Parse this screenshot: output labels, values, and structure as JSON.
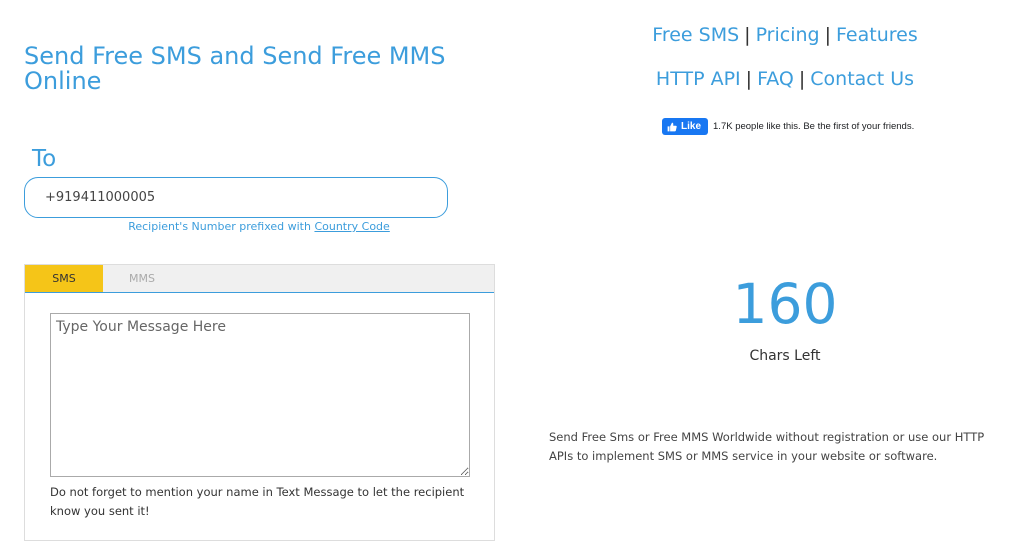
{
  "header": {
    "title": "Send Free SMS and Send Free MMS Online"
  },
  "nav": {
    "row1": [
      "Free SMS",
      "Pricing",
      "Features"
    ],
    "row2": [
      "HTTP API",
      "FAQ",
      "Contact Us"
    ],
    "separator": "|"
  },
  "facebook": {
    "like_label": "Like",
    "like_icon": "thumbs-up-icon",
    "social_text": "1.7K people like this. Be the first of your friends."
  },
  "form": {
    "to_label": "To",
    "recipient_value": "+919411000005",
    "hint_prefix": "Recipient's Number prefixed with",
    "hint_link": "Country Code"
  },
  "tabs": [
    {
      "label": "SMS",
      "active": true
    },
    {
      "label": "MMS",
      "active": false
    }
  ],
  "message": {
    "placeholder": "Type Your Message Here",
    "note": "Do not forget to mention your name in Text Message to let the recipient know you sent it!"
  },
  "counter": {
    "value": "160",
    "label": "Chars Left"
  },
  "description": "Send Free Sms or Free MMS Worldwide without registration or use our HTTP APIs to implement SMS or MMS service in your website or software.",
  "colors": {
    "accent": "#3c9ddc",
    "active_tab": "#f5c518",
    "facebook_blue": "#1877f2"
  }
}
